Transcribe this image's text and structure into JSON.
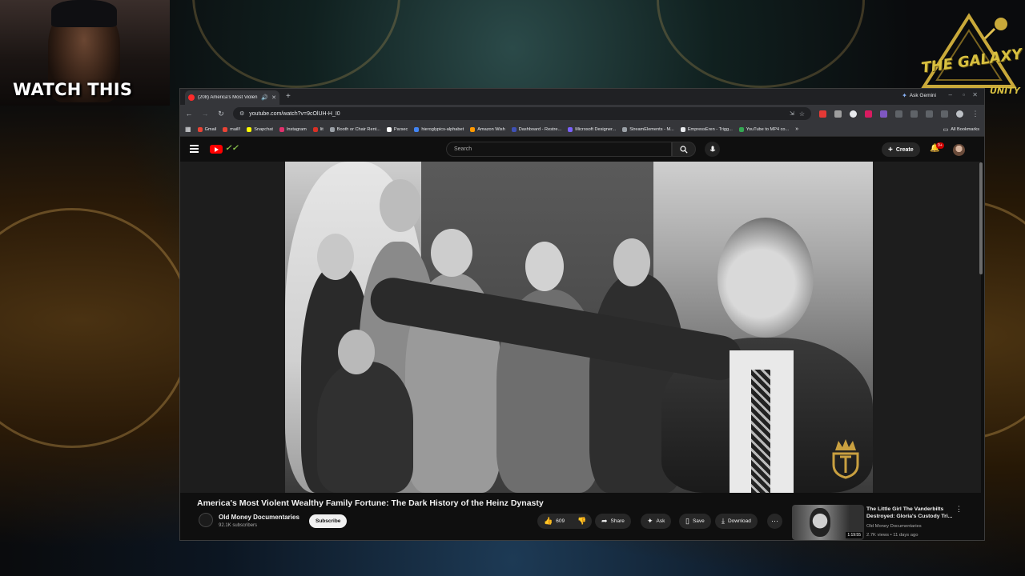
{
  "overlay": {
    "watch_title": "WATCH THIS",
    "logo_text": "THE GALAXY",
    "logo_sub": "UNITY"
  },
  "browser": {
    "tab_title": "(208) America's Most Violen",
    "gemini_label": "Ask Gemini",
    "url": "youtube.com/watch?v=9cOlUH-H_I0",
    "bookmarks": [
      {
        "label": "Gmail",
        "color": "#ea4335"
      },
      {
        "label": "maill!",
        "color": "#ea4335"
      },
      {
        "label": "Snapchat",
        "color": "#fffc00"
      },
      {
        "label": "Instagram",
        "color": "#e1306c"
      },
      {
        "label": "lit",
        "color": "#d93025"
      },
      {
        "label": "Booth or Chair Rent...",
        "color": "#9aa0a6"
      },
      {
        "label": "Parsec",
        "color": "#ffffff"
      },
      {
        "label": "hieroglypics-alphabet",
        "color": "#4285f4"
      },
      {
        "label": "Amazon Wish",
        "color": "#ff9900"
      },
      {
        "label": "Dashboard - Restre...",
        "color": "#3f51b5"
      },
      {
        "label": "Microsoft Designer...",
        "color": "#7b61ff"
      },
      {
        "label": "StreamElements - M...",
        "color": "#9aa0a6"
      },
      {
        "label": "EmpressEren - Trigg...",
        "color": "#e8eaed"
      },
      {
        "label": "YouTube to MP4 co...",
        "color": "#34a853"
      }
    ],
    "all_bookmarks": "All Bookmarks"
  },
  "youtube": {
    "search_placeholder": "Search",
    "create_label": "Create",
    "notif_count": "9+",
    "video_title": "America's Most Violent Wealthy Family Fortune: The Dark History of the Heinz Dynasty",
    "channel_name": "Old Money Documentaries",
    "channel_subs": "92.1K subscribers",
    "subscribe_label": "Subscribe",
    "like_count": "609",
    "share_label": "Share",
    "ask_label": "Ask",
    "save_label": "Save",
    "download_label": "Download",
    "recommended": {
      "title": "The Little Girl The Vanderbilts Destroyed: Gloria's Custody Tri...",
      "channel": "Old Money Documentaries",
      "meta": "2.7K views • 11 days ago",
      "duration": "1:19:55"
    }
  },
  "colors": {
    "accent_red": "#ff0000",
    "logo_gold": "#d8c040"
  }
}
